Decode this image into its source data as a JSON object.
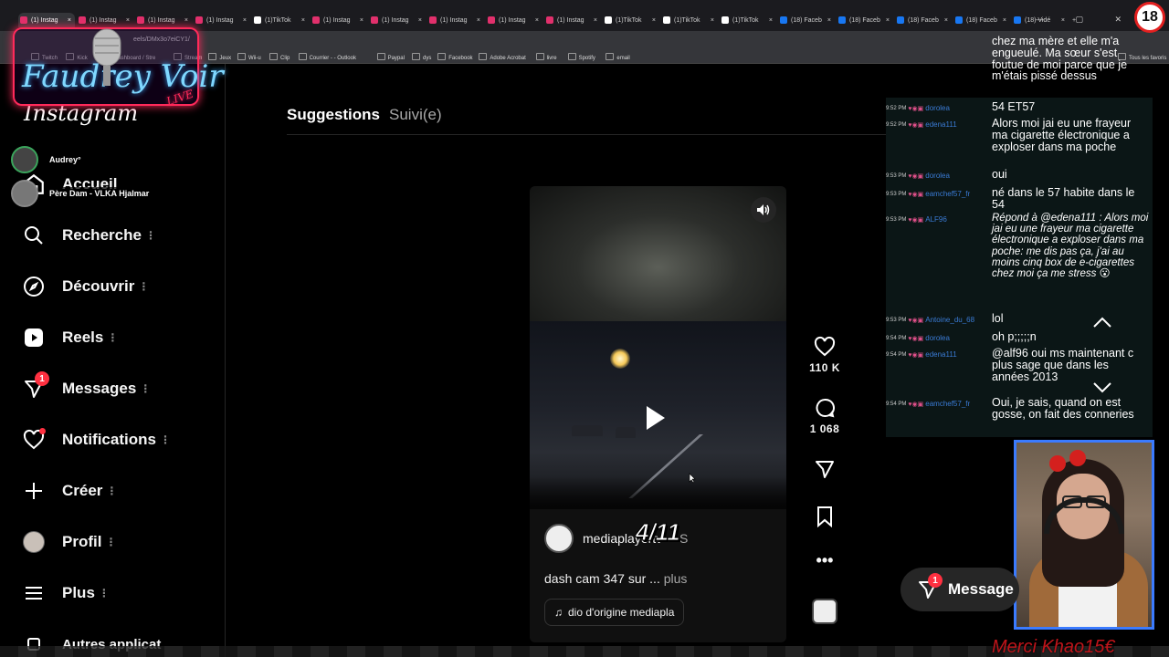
{
  "browser": {
    "tabs": [
      {
        "label": "(1) Instag",
        "icon": "instagram-icon",
        "active": true
      },
      {
        "label": "(1) Instag",
        "icon": "instagram-icon"
      },
      {
        "label": "(1) Instag",
        "icon": "instagram-icon"
      },
      {
        "label": "(1) Instag",
        "icon": "instagram-icon"
      },
      {
        "label": "(1)TikTok",
        "icon": "tiktok-icon"
      },
      {
        "label": "(1) Instag",
        "icon": "instagram-icon"
      },
      {
        "label": "(1) Instag",
        "icon": "instagram-icon"
      },
      {
        "label": "(1) Instag",
        "icon": "instagram-icon"
      },
      {
        "label": "(1) Instag",
        "icon": "instagram-icon"
      },
      {
        "label": "(1) Instag",
        "icon": "instagram-icon"
      },
      {
        "label": "(1)TikTok",
        "icon": "tiktok-icon"
      },
      {
        "label": "(1)TikTok",
        "icon": "tiktok-icon"
      },
      {
        "label": "(1)TikTok",
        "icon": "tiktok-icon"
      },
      {
        "label": "(18) Faceb",
        "icon": "facebook-icon"
      },
      {
        "label": "(18) Faceb",
        "icon": "facebook-icon"
      },
      {
        "label": "(18) Faceb",
        "icon": "facebook-icon"
      },
      {
        "label": "(18) Faceb",
        "icon": "facebook-icon"
      },
      {
        "label": "(18) Vidé",
        "icon": "facebook-icon"
      }
    ],
    "new_tab": "+",
    "url": "eels/DMx3o7eiCY1/",
    "bookmarks": [
      "Twitch",
      "Kick",
      "(4) Dashboard / Stre",
      "Stream",
      "Jeux",
      "Wii-u",
      "Clip",
      "Courrier - - Outlook",
      "Paypal",
      "dys",
      "Facebook",
      "Adobe Acrobat",
      "livre",
      "Spotify",
      "email"
    ],
    "bookmarks_right": "Tous les favoris",
    "colors": {
      "instagram": "#e1306c",
      "tiktok": "#ffffff",
      "facebook": "#1877f2"
    }
  },
  "overlay": {
    "logo_text": "Faudrey Voir",
    "logo_live": "LIVE",
    "viewers": [
      {
        "name": "Audrey°"
      },
      {
        "name": "Père Dam - VLKA Hjalmar"
      }
    ],
    "age_badge": "18",
    "merci": "Merci Khao15€"
  },
  "sidebar": {
    "logo": "Instagram",
    "items": [
      {
        "label": "Accueil",
        "icon": "home-icon"
      },
      {
        "label": "Recherche",
        "icon": "search-icon"
      },
      {
        "label": "Découvrir",
        "icon": "compass-icon"
      },
      {
        "label": "Reels",
        "icon": "reels-icon"
      },
      {
        "label": "Messages",
        "icon": "messenger-icon",
        "badge": "1"
      },
      {
        "label": "Notifications",
        "icon": "heart-icon"
      },
      {
        "label": "Créer",
        "icon": "plus-icon"
      },
      {
        "label": "Profil",
        "icon": "avatar-icon"
      },
      {
        "label": "Plus",
        "icon": "menu-icon"
      },
      {
        "label": "Autres applicat",
        "icon": "apps-icon"
      }
    ]
  },
  "feed": {
    "tab_suggestions": "Suggestions",
    "tab_following": "Suivi(e)",
    "reel": {
      "author": "mediaplayertv",
      "follow_hint": "• S",
      "counter": "4/11",
      "caption": "dash cam 347 sur ...",
      "more": "plus",
      "audio": "dio d'origine mediapla"
    },
    "actions": {
      "likes": "110 K",
      "comments": "1 068"
    }
  },
  "chat": [
    {
      "user": "",
      "time": "",
      "text": "chez ma mère et elle m'a engueulé. Ma sœur s'est foutue de moi parce que je m'étais pissé dessus"
    },
    {
      "user": "dorolea",
      "time": "9:52 PM",
      "text": "54 ET57"
    },
    {
      "user": "edena111",
      "time": "9:52 PM",
      "text": "Alors moi jai eu une frayeur ma cigarette électronique a exploser dans ma poche"
    },
    {
      "user": "dorolea",
      "time": "9:53 PM",
      "text": "oui"
    },
    {
      "user": "eamchef57_fr",
      "time": "9:53 PM",
      "text": "né dans le 57 habite dans le 54"
    },
    {
      "user": "ALF96",
      "time": "9:53 PM",
      "text": "Répond à @edena111 : Alors moi jai eu une frayeur ma cigarette électronique a exploser dans ma poche: me dis pas ça, j'ai au moins cinq box de e-cigarettes chez moi ça me stress 😮",
      "reply": true
    },
    {
      "user": "Antoine_du_68",
      "time": "9:53 PM",
      "text": "lol"
    },
    {
      "user": "dorolea",
      "time": "9:54 PM",
      "text": "oh p;;;;;n"
    },
    {
      "user": "edena111",
      "time": "9:54 PM",
      "text": "@alf96 oui ms maintenant c plus sage que dans les années 2013"
    },
    {
      "user": "eamchef57_fr",
      "time": "9:54 PM",
      "text": "Oui, je sais, quand on est gosse, on fait des conneries"
    }
  ],
  "floating": {
    "messages_label": "Message",
    "messages_badge": "1"
  }
}
